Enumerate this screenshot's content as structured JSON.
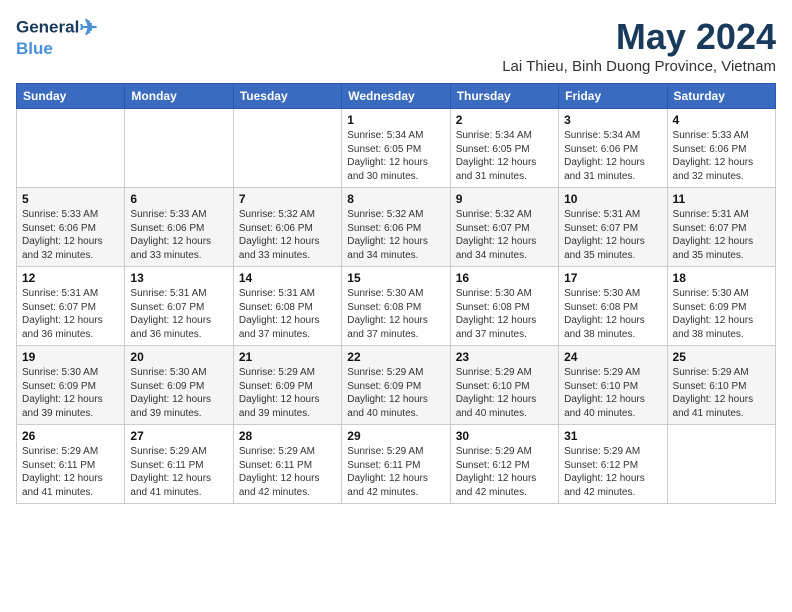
{
  "logo": {
    "line1": "General",
    "line2": "Blue"
  },
  "title": {
    "month_year": "May 2024",
    "location": "Lai Thieu, Binh Duong Province, Vietnam"
  },
  "days_of_week": [
    "Sunday",
    "Monday",
    "Tuesday",
    "Wednesday",
    "Thursday",
    "Friday",
    "Saturday"
  ],
  "weeks": [
    [
      {
        "day": "",
        "info": ""
      },
      {
        "day": "",
        "info": ""
      },
      {
        "day": "",
        "info": ""
      },
      {
        "day": "1",
        "info": "Sunrise: 5:34 AM\nSunset: 6:05 PM\nDaylight: 12 hours\nand 30 minutes."
      },
      {
        "day": "2",
        "info": "Sunrise: 5:34 AM\nSunset: 6:05 PM\nDaylight: 12 hours\nand 31 minutes."
      },
      {
        "day": "3",
        "info": "Sunrise: 5:34 AM\nSunset: 6:06 PM\nDaylight: 12 hours\nand 31 minutes."
      },
      {
        "day": "4",
        "info": "Sunrise: 5:33 AM\nSunset: 6:06 PM\nDaylight: 12 hours\nand 32 minutes."
      }
    ],
    [
      {
        "day": "5",
        "info": "Sunrise: 5:33 AM\nSunset: 6:06 PM\nDaylight: 12 hours\nand 32 minutes."
      },
      {
        "day": "6",
        "info": "Sunrise: 5:33 AM\nSunset: 6:06 PM\nDaylight: 12 hours\nand 33 minutes."
      },
      {
        "day": "7",
        "info": "Sunrise: 5:32 AM\nSunset: 6:06 PM\nDaylight: 12 hours\nand 33 minutes."
      },
      {
        "day": "8",
        "info": "Sunrise: 5:32 AM\nSunset: 6:06 PM\nDaylight: 12 hours\nand 34 minutes."
      },
      {
        "day": "9",
        "info": "Sunrise: 5:32 AM\nSunset: 6:07 PM\nDaylight: 12 hours\nand 34 minutes."
      },
      {
        "day": "10",
        "info": "Sunrise: 5:31 AM\nSunset: 6:07 PM\nDaylight: 12 hours\nand 35 minutes."
      },
      {
        "day": "11",
        "info": "Sunrise: 5:31 AM\nSunset: 6:07 PM\nDaylight: 12 hours\nand 35 minutes."
      }
    ],
    [
      {
        "day": "12",
        "info": "Sunrise: 5:31 AM\nSunset: 6:07 PM\nDaylight: 12 hours\nand 36 minutes."
      },
      {
        "day": "13",
        "info": "Sunrise: 5:31 AM\nSunset: 6:07 PM\nDaylight: 12 hours\nand 36 minutes."
      },
      {
        "day": "14",
        "info": "Sunrise: 5:31 AM\nSunset: 6:08 PM\nDaylight: 12 hours\nand 37 minutes."
      },
      {
        "day": "15",
        "info": "Sunrise: 5:30 AM\nSunset: 6:08 PM\nDaylight: 12 hours\nand 37 minutes."
      },
      {
        "day": "16",
        "info": "Sunrise: 5:30 AM\nSunset: 6:08 PM\nDaylight: 12 hours\nand 37 minutes."
      },
      {
        "day": "17",
        "info": "Sunrise: 5:30 AM\nSunset: 6:08 PM\nDaylight: 12 hours\nand 38 minutes."
      },
      {
        "day": "18",
        "info": "Sunrise: 5:30 AM\nSunset: 6:09 PM\nDaylight: 12 hours\nand 38 minutes."
      }
    ],
    [
      {
        "day": "19",
        "info": "Sunrise: 5:30 AM\nSunset: 6:09 PM\nDaylight: 12 hours\nand 39 minutes."
      },
      {
        "day": "20",
        "info": "Sunrise: 5:30 AM\nSunset: 6:09 PM\nDaylight: 12 hours\nand 39 minutes."
      },
      {
        "day": "21",
        "info": "Sunrise: 5:29 AM\nSunset: 6:09 PM\nDaylight: 12 hours\nand 39 minutes."
      },
      {
        "day": "22",
        "info": "Sunrise: 5:29 AM\nSunset: 6:09 PM\nDaylight: 12 hours\nand 40 minutes."
      },
      {
        "day": "23",
        "info": "Sunrise: 5:29 AM\nSunset: 6:10 PM\nDaylight: 12 hours\nand 40 minutes."
      },
      {
        "day": "24",
        "info": "Sunrise: 5:29 AM\nSunset: 6:10 PM\nDaylight: 12 hours\nand 40 minutes."
      },
      {
        "day": "25",
        "info": "Sunrise: 5:29 AM\nSunset: 6:10 PM\nDaylight: 12 hours\nand 41 minutes."
      }
    ],
    [
      {
        "day": "26",
        "info": "Sunrise: 5:29 AM\nSunset: 6:11 PM\nDaylight: 12 hours\nand 41 minutes."
      },
      {
        "day": "27",
        "info": "Sunrise: 5:29 AM\nSunset: 6:11 PM\nDaylight: 12 hours\nand 41 minutes."
      },
      {
        "day": "28",
        "info": "Sunrise: 5:29 AM\nSunset: 6:11 PM\nDaylight: 12 hours\nand 42 minutes."
      },
      {
        "day": "29",
        "info": "Sunrise: 5:29 AM\nSunset: 6:11 PM\nDaylight: 12 hours\nand 42 minutes."
      },
      {
        "day": "30",
        "info": "Sunrise: 5:29 AM\nSunset: 6:12 PM\nDaylight: 12 hours\nand 42 minutes."
      },
      {
        "day": "31",
        "info": "Sunrise: 5:29 AM\nSunset: 6:12 PM\nDaylight: 12 hours\nand 42 minutes."
      },
      {
        "day": "",
        "info": ""
      }
    ]
  ]
}
